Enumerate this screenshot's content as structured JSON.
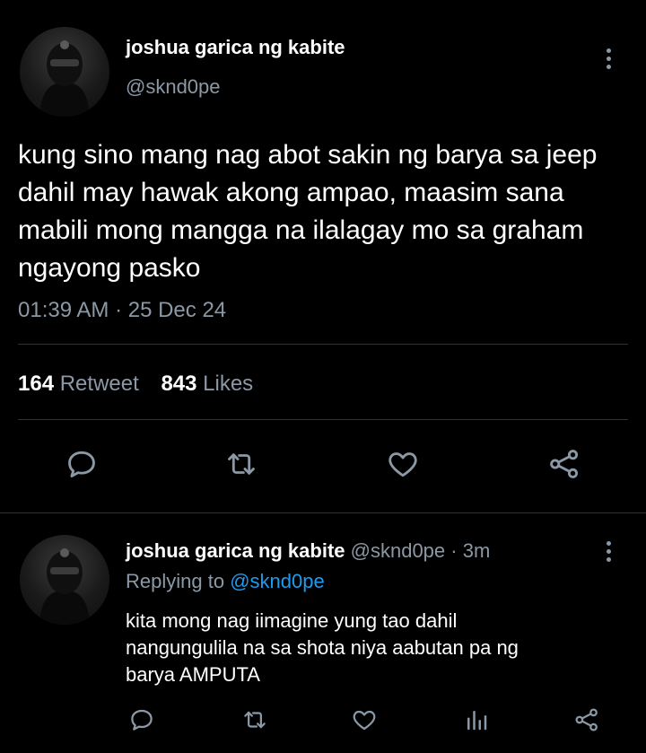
{
  "main_tweet": {
    "display_name": "joshua garica ng kabite",
    "handle": "@sknd0pe",
    "text_lines": [
      "kung sino mang nag abot sakin ng barya sa jeep",
      "dahil may hawak akong ampao, maasim sana",
      "mabili mong mangga na ilalagay mo sa graham",
      "ngayong pasko"
    ],
    "timestamp": "01:39 AM · 25 Dec 24",
    "retweet_count": "164",
    "retweet_label": "Retweet",
    "like_count": "843",
    "like_label": "Likes",
    "actions": [
      "reply-icon",
      "retweet-icon",
      "like-icon",
      "share-icon"
    ]
  },
  "reply_tweet": {
    "display_name": "joshua garica ng kabite",
    "handle": "@sknd0pe",
    "time_ago": "· 3m",
    "replying_prefix": "Replying to",
    "replying_handle": "@sknd0pe",
    "text_lines": [
      "kita mong nag iimagine yung tao dahil",
      "nangungulila na sa shota niya aabutan pa ng",
      "barya AMPUTA"
    ],
    "actions": [
      "reply-icon",
      "retweet-icon",
      "like-icon",
      "analytics-icon",
      "share-icon"
    ]
  },
  "colors": {
    "background": "#000000",
    "text": "#ffffff",
    "muted": "#8b98a5",
    "link": "#1d9bf0",
    "divider": "#2f3336"
  }
}
